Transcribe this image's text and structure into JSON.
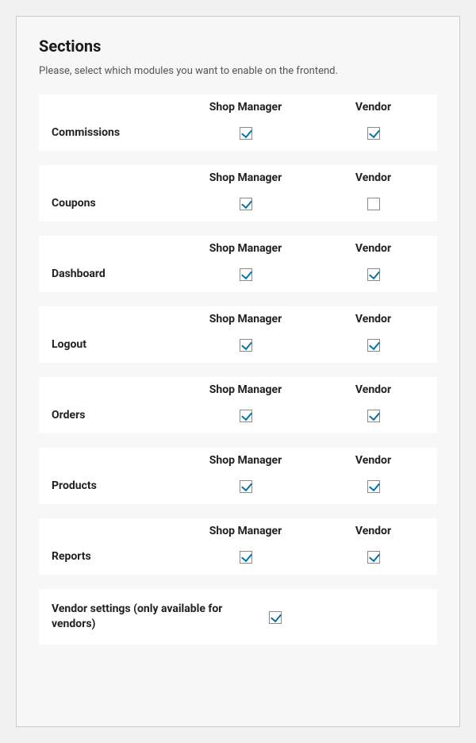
{
  "title": "Sections",
  "description": "Please, select which modules you want to enable on the frontend.",
  "columns": {
    "shop_manager": "Shop Manager",
    "vendor": "Vendor"
  },
  "sections": [
    {
      "key": "commissions",
      "label": "Commissions",
      "shop_manager": true,
      "vendor": true
    },
    {
      "key": "coupons",
      "label": "Coupons",
      "shop_manager": true,
      "vendor": false
    },
    {
      "key": "dashboard",
      "label": "Dashboard",
      "shop_manager": true,
      "vendor": true
    },
    {
      "key": "logout",
      "label": "Logout",
      "shop_manager": true,
      "vendor": true
    },
    {
      "key": "orders",
      "label": "Orders",
      "shop_manager": true,
      "vendor": true
    },
    {
      "key": "products",
      "label": "Products",
      "shop_manager": true,
      "vendor": true
    },
    {
      "key": "reports",
      "label": "Reports",
      "shop_manager": true,
      "vendor": true
    }
  ],
  "vendor_only": {
    "label": "Vendor settings (only available for vendors)",
    "checked": true
  }
}
